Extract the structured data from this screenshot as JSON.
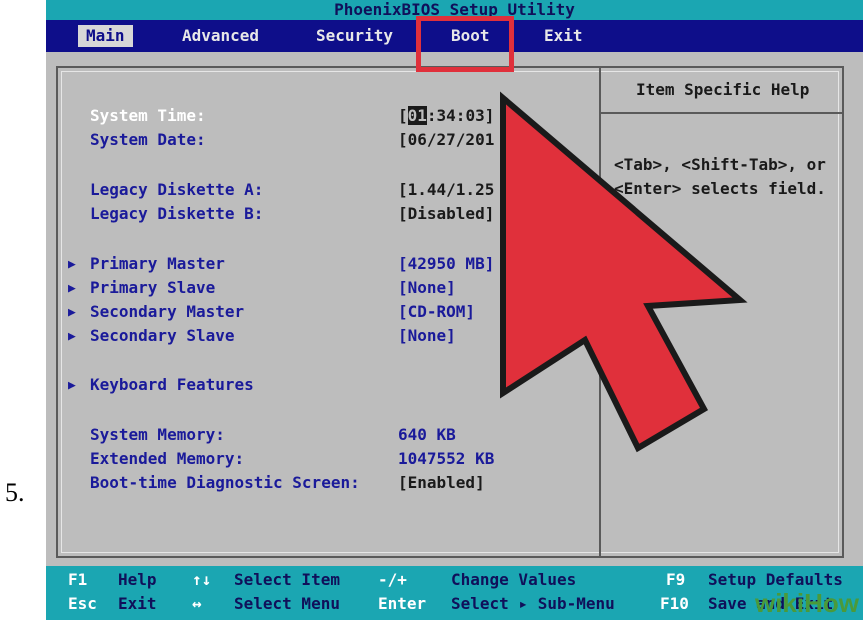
{
  "step": {
    "number": "5."
  },
  "title_bar": {
    "title": "PhoenixBIOS Setup Utility"
  },
  "menu": {
    "tabs": [
      {
        "label": "Main"
      },
      {
        "label": "Advanced"
      },
      {
        "label": "Security"
      },
      {
        "label": "Boot"
      },
      {
        "label": "Exit"
      }
    ],
    "active": "Main",
    "annotated": "Boot"
  },
  "main": {
    "system_time": {
      "label": "System Time:",
      "value_cursor": "01",
      "value_rest": ":34:03]",
      "value_open": "["
    },
    "system_date": {
      "label": "System Date:",
      "value": "[06/27/201"
    },
    "legacy_a": {
      "label": "Legacy Diskette A:",
      "value": "[1.44/1.25"
    },
    "legacy_b": {
      "label": "Legacy Diskette B:",
      "value": "[Disabled]"
    },
    "primary_master": {
      "label": "Primary Master",
      "value": "[42950 MB]"
    },
    "primary_slave": {
      "label": "Primary Slave",
      "value": "[None]"
    },
    "secondary_master": {
      "label": "Secondary Master",
      "value": "[CD-ROM]"
    },
    "secondary_slave": {
      "label": "Secondary Slave",
      "value": "[None]"
    },
    "keyboard": {
      "label": "Keyboard Features"
    },
    "system_memory": {
      "label": "System Memory:",
      "value": "640 KB"
    },
    "extended_memory": {
      "label": "Extended Memory:",
      "value": "1047552 KB"
    },
    "diag_screen": {
      "label": "Boot-time Diagnostic Screen:",
      "value": "[Enabled]"
    }
  },
  "help": {
    "title": "Item Specific Help",
    "line1": "<Tab>, <Shift-Tab>, or",
    "line2": "<Enter> selects field."
  },
  "footer": {
    "f1_key": "F1",
    "f1_desc": "Help",
    "arrows_ud": "↑↓",
    "select_item": "Select Item",
    "minus_plus": "-/+",
    "change_values": "Change Values",
    "f9_key": "F9",
    "setup_defaults": "Setup Defaults",
    "esc_key": "Esc",
    "exit_desc": "Exit",
    "arrows_lr": "↔",
    "select_menu": "Select Menu",
    "enter_key": "Enter",
    "select_submenu": "Select ▸ Sub-Menu",
    "f10_key": "F10",
    "save_exit": "Save and Exit"
  },
  "watermark": {
    "text": "wikiHow"
  },
  "colors": {
    "title_bar": "#1ba6b2",
    "menu_bar": "#0e0e8a",
    "panel": "#bdbdbd",
    "annotation_red": "#e0303b"
  },
  "icons": {
    "pointer": "arrow-cursor-icon",
    "submenu": "triangle-right-icon"
  }
}
